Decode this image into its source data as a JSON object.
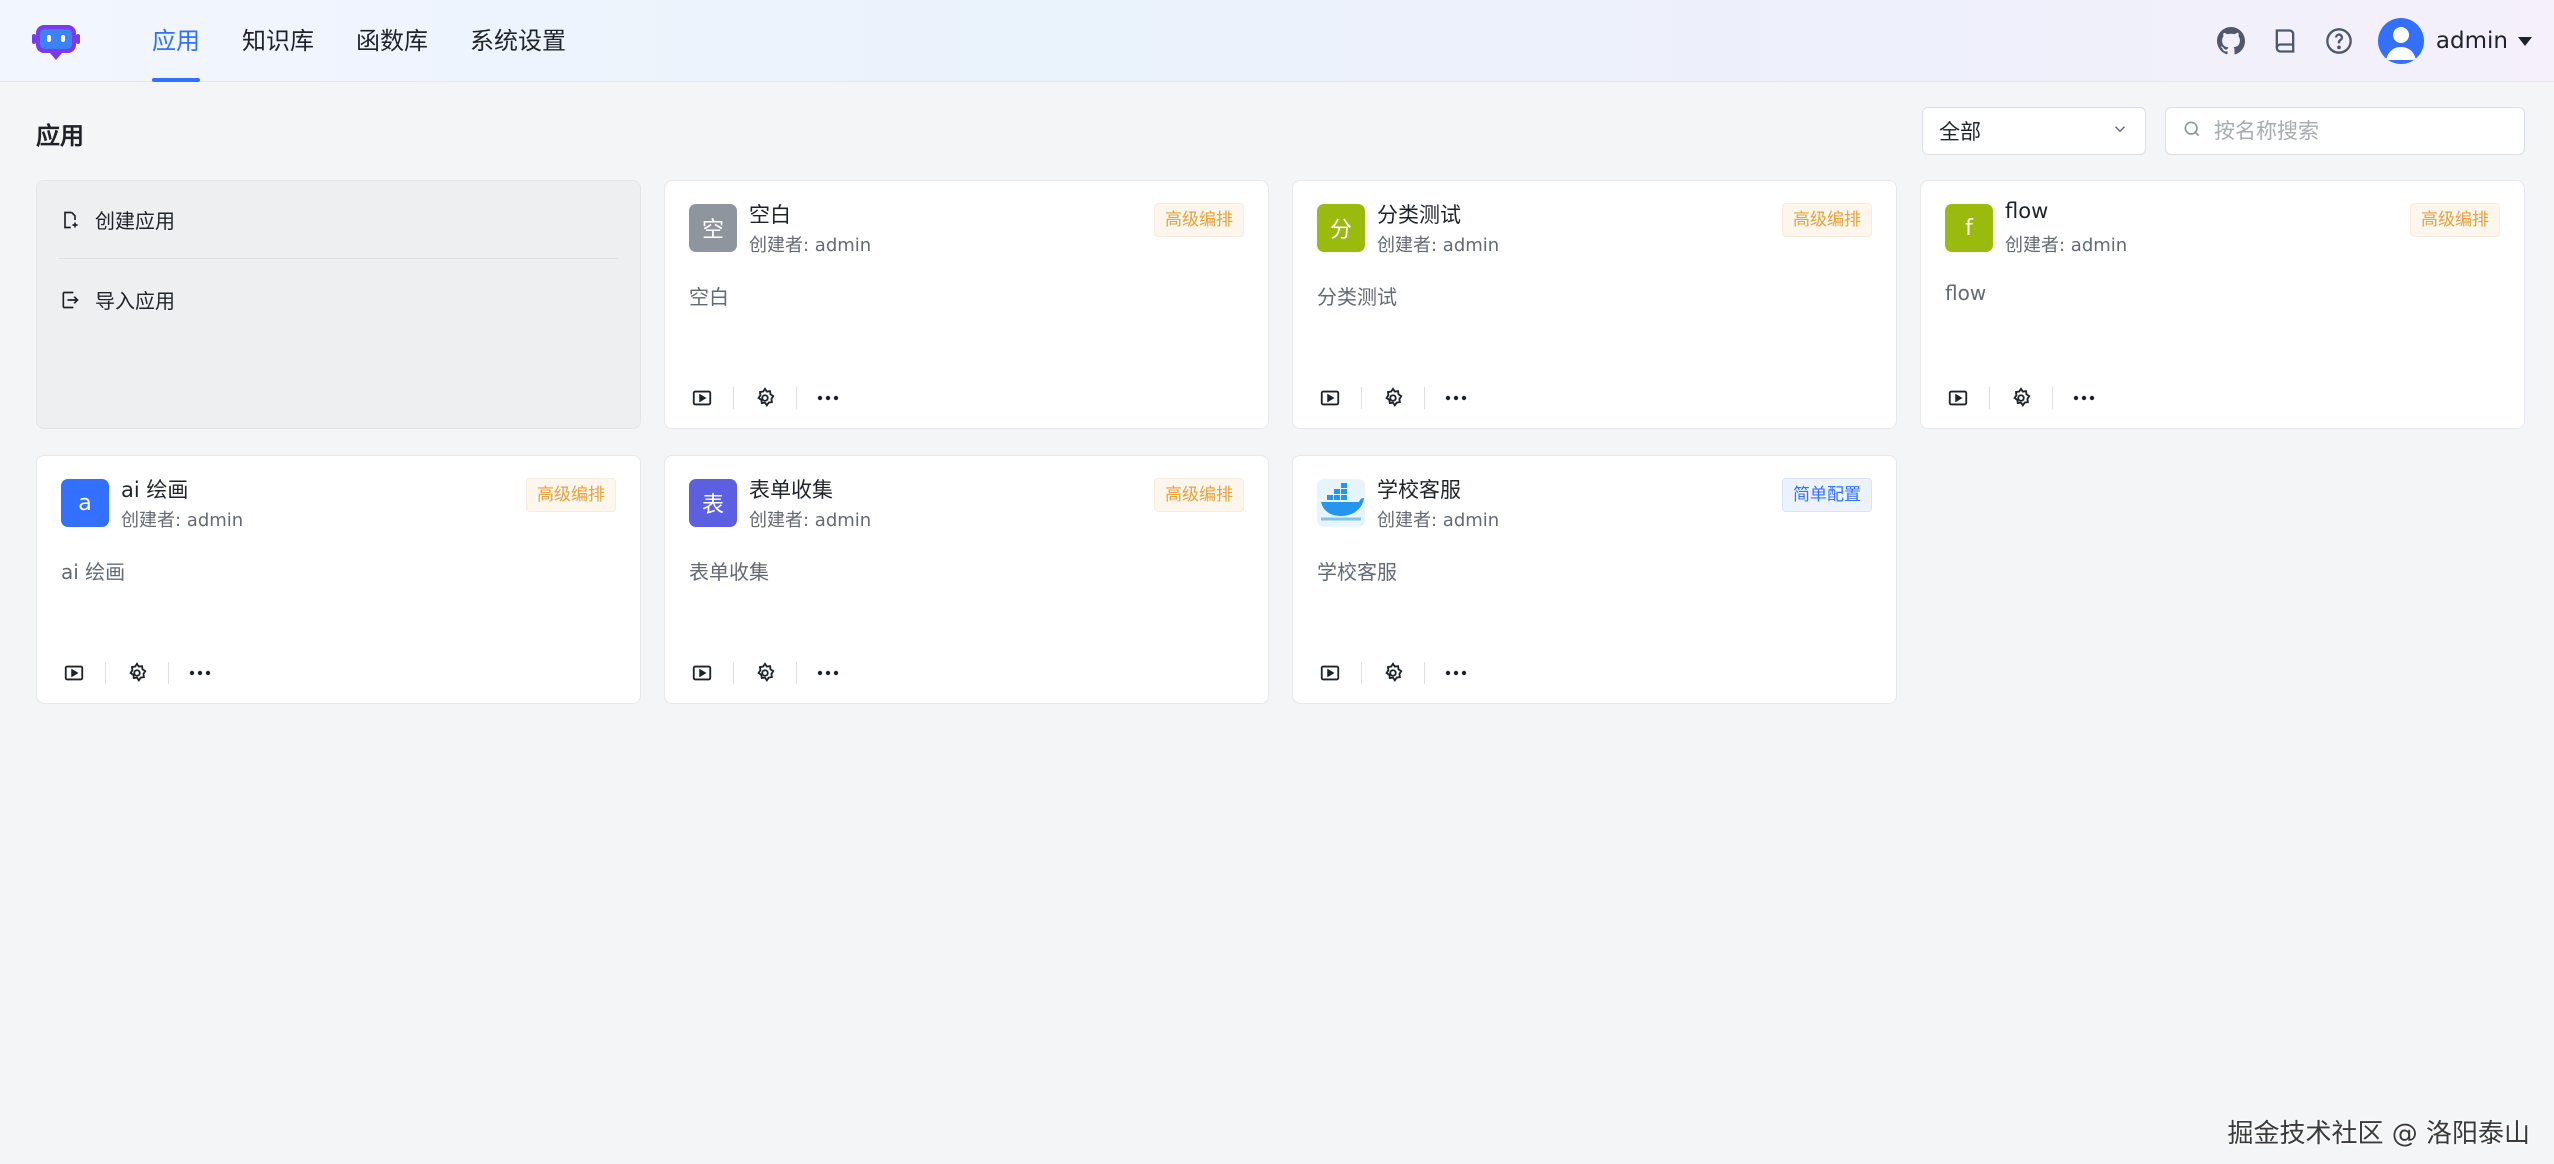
{
  "topbar": {
    "logo_icon": "robot-logo",
    "nav": [
      {
        "label": "应用",
        "active": true
      },
      {
        "label": "知识库",
        "active": false
      },
      {
        "label": "函数库",
        "active": false
      },
      {
        "label": "系统设置",
        "active": false
      }
    ],
    "icons": [
      "github-icon",
      "book-icon",
      "help-icon"
    ],
    "username": "admin"
  },
  "page": {
    "title": "应用",
    "filter": {
      "value": "全部"
    },
    "search": {
      "placeholder": "按名称搜索",
      "value": ""
    }
  },
  "create_card": {
    "create_label": "创建应用",
    "import_label": "导入应用"
  },
  "apps": [
    {
      "name": "空白",
      "icon_text": "空",
      "icon_color": "#8f959e",
      "creator": "创建者: admin",
      "tag": "高级编排",
      "tag_type": "adv",
      "desc": "空白"
    },
    {
      "name": "分类测试",
      "icon_text": "分",
      "icon_color": "#9aba0e",
      "creator": "创建者: admin",
      "tag": "高级编排",
      "tag_type": "adv",
      "desc": "分类测试"
    },
    {
      "name": "flow",
      "icon_text": "f",
      "icon_color": "#9aba0e",
      "creator": "创建者: admin",
      "tag": "高级编排",
      "tag_type": "adv",
      "desc": "flow"
    },
    {
      "name": "ai 绘画",
      "icon_text": "a",
      "icon_color": "#3370ff",
      "creator": "创建者: admin",
      "tag": "高级编排",
      "tag_type": "adv",
      "desc": "ai 绘画"
    },
    {
      "name": "表单收集",
      "icon_text": "表",
      "icon_color": "#5b5fe0",
      "creator": "创建者: admin",
      "tag": "高级编排",
      "tag_type": "adv",
      "desc": "表单收集"
    },
    {
      "name": "学校客服",
      "icon_text": "",
      "icon_color": "#e8f4fb",
      "creator": "创建者: admin",
      "tag": "简单配置",
      "tag_type": "simple",
      "desc": "学校客服"
    }
  ],
  "watermark": "掘金技术社区 @ 洛阳泰山"
}
